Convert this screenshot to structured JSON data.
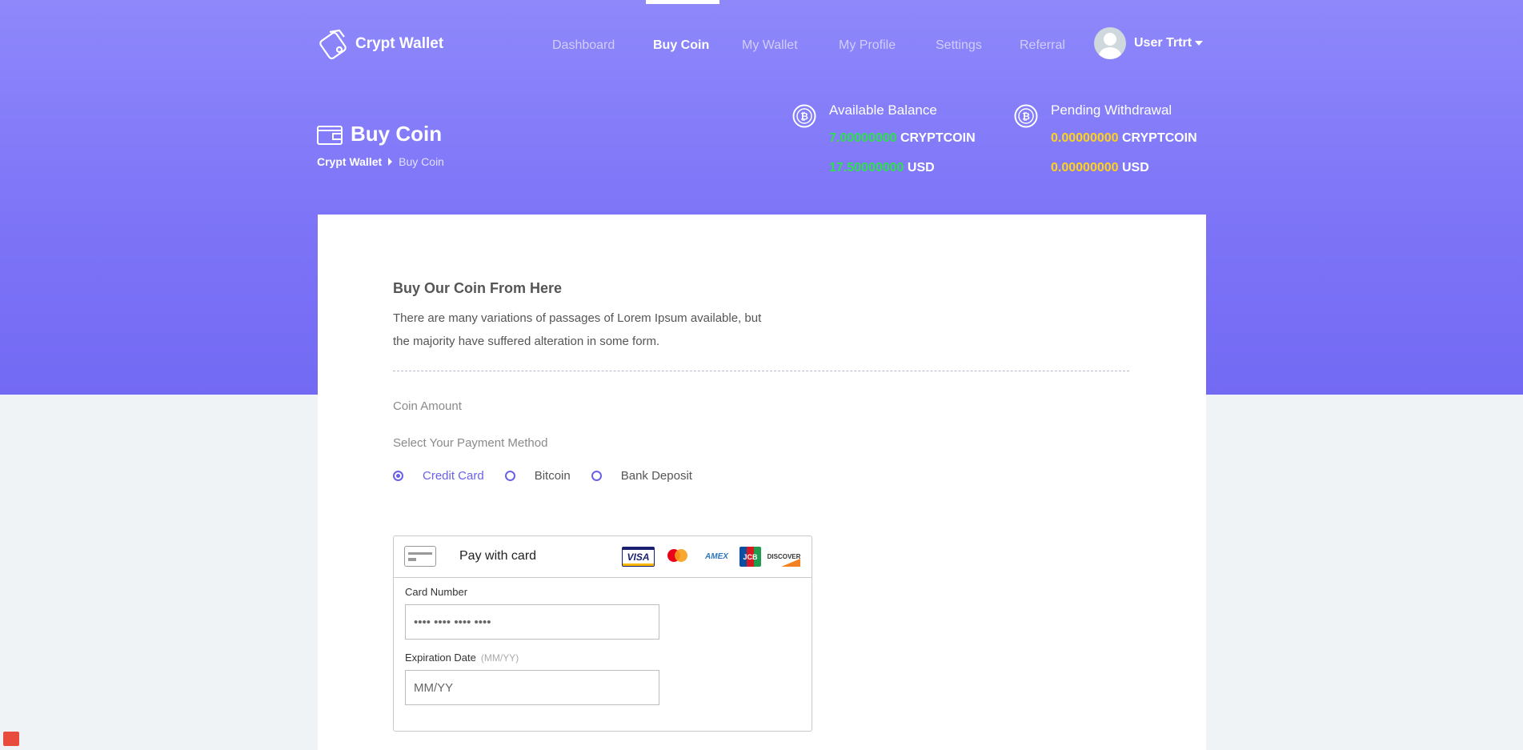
{
  "header": {
    "app_name": "Crypt Wallet",
    "logo_icon": "wallet-logo-icon",
    "nav": [
      {
        "label": "Dashboard",
        "active": false
      },
      {
        "label": "Buy Coin",
        "active": true
      },
      {
        "label": "My Wallet",
        "active": false
      },
      {
        "label": "My Profile",
        "active": false
      },
      {
        "label": "Settings",
        "active": false
      },
      {
        "label": "Referral",
        "active": false
      }
    ],
    "user_name": "User Trtrt"
  },
  "page": {
    "title": "Buy Coin",
    "breadcrumb": [
      "Crypt Wallet",
      "Buy Coin"
    ]
  },
  "balances": {
    "available": {
      "title": "Available Balance",
      "coin_amount": "7.00000000",
      "coin_unit": "CRYPTCOIN",
      "usd_amount": "17.50000000",
      "usd_unit": "USD"
    },
    "pending": {
      "title": "Pending Withdrawal",
      "coin_amount": "0.00000000",
      "coin_unit": "CRYPTCOIN",
      "usd_amount": "0.00000000",
      "usd_unit": "USD"
    }
  },
  "form": {
    "title": "Buy Our Coin From Here",
    "description": "There are many variations of passages of Lorem Ipsum available, but the majority have suffered alteration in some form.",
    "coin_amount_label": "Coin Amount",
    "payment_method_label": "Select Your Payment Method",
    "payment_methods": [
      {
        "label": "Credit Card",
        "selected": true
      },
      {
        "label": "Bitcoin",
        "selected": false
      },
      {
        "label": "Bank Deposit",
        "selected": false
      }
    ]
  },
  "card_box": {
    "title": "Pay with card",
    "brands": [
      "VISA",
      "MasterCard",
      "AMEX",
      "JCB",
      "DISCOVER"
    ],
    "card_number_label": "Card Number",
    "card_number_placeholder": "•••• •••• •••• ••••",
    "expiration_label": "Expiration Date",
    "expiration_hint": "(MM/YY)",
    "expiration_placeholder": "MM/YY"
  },
  "colors": {
    "hero_top": "#8e88fb",
    "hero_bottom": "#736af4",
    "accent": "#6a61e8",
    "balance_green": "#2ee04e",
    "balance_yellow": "#ffd31a"
  }
}
